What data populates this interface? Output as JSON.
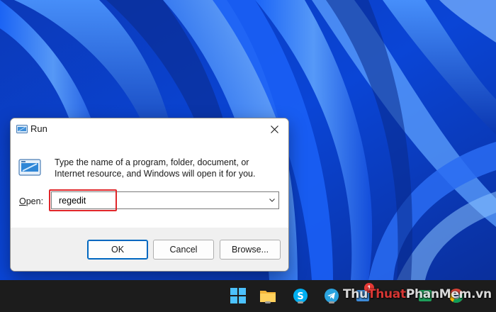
{
  "dialog": {
    "title": "Run",
    "description": "Type the name of a program, folder, document, or Internet resource, and Windows will open it for you.",
    "open_label_accel": "O",
    "open_label_rest": "pen:",
    "input_value": "regedit",
    "buttons": {
      "ok": "OK",
      "cancel": "Cancel",
      "browse": "Browse..."
    },
    "icons": {
      "title": "run-icon",
      "big": "run-icon",
      "close": "close-icon",
      "dropdown": "chevron-down-icon"
    }
  },
  "taskbar": {
    "icons": [
      "windows-start-icon",
      "file-explorer-icon",
      "skype-icon",
      "telegram-icon",
      "app-icon",
      "app-icon",
      "chrome-icon"
    ],
    "notification_count": "1"
  },
  "watermark": {
    "part1": "Thu",
    "part2": "Thuat",
    "part3": "PhanMem",
    "part4": ".vn"
  },
  "colors": {
    "wallpaper": "#0a3fc8",
    "taskbar": "#1c1c1c",
    "highlight": "#e0262a",
    "accent": "#0067c0"
  }
}
